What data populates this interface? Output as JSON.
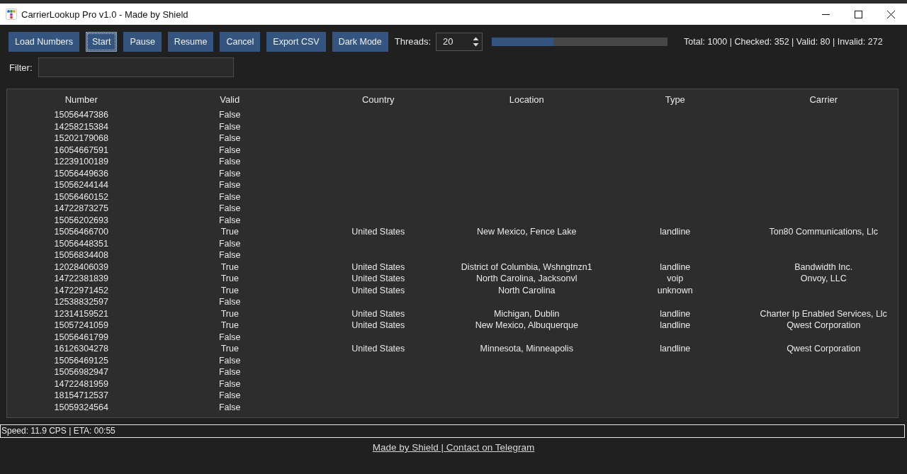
{
  "window": {
    "title": "CarrierLookup Pro v1.0 - Made by Shield"
  },
  "toolbar": {
    "buttons": [
      {
        "label": "Load Numbers",
        "focused": false
      },
      {
        "label": "Start",
        "focused": true
      },
      {
        "label": "Pause",
        "focused": false
      },
      {
        "label": "Resume",
        "focused": false
      },
      {
        "label": "Cancel",
        "focused": false
      },
      {
        "label": "Export CSV",
        "focused": false
      },
      {
        "label": "Dark Mode",
        "focused": false
      }
    ],
    "threads": {
      "label": "Threads:",
      "value": "20"
    },
    "progress": {
      "level": 0.352
    },
    "stats": "Total: 1000 | Checked: 352 | Valid: 80 | Invalid: 272"
  },
  "filter": {
    "label": "Filter:"
  },
  "table": {
    "columns": [
      "Number",
      "Valid",
      "Country",
      "Location",
      "Type",
      "Carrier"
    ],
    "rows": [
      {
        "number": "15056447386",
        "valid": "False"
      },
      {
        "number": "14258215384",
        "valid": "False"
      },
      {
        "number": "15202179068",
        "valid": "False"
      },
      {
        "number": "16054667591",
        "valid": "False"
      },
      {
        "number": "12239100189",
        "valid": "False"
      },
      {
        "number": "15056449636",
        "valid": "False"
      },
      {
        "number": "15056244144",
        "valid": "False"
      },
      {
        "number": "15056460152",
        "valid": "False"
      },
      {
        "number": "14722873275",
        "valid": "False"
      },
      {
        "number": "15056202693",
        "valid": "False"
      },
      {
        "number": "15056466700",
        "valid": "True",
        "country": "United States",
        "location": "New Mexico, Fence Lake",
        "type": "landline",
        "carrier": "Ton80 Communications, Llc"
      },
      {
        "number": "15056448351",
        "valid": "False"
      },
      {
        "number": "15056834408",
        "valid": "False"
      },
      {
        "number": "12028406039",
        "valid": "True",
        "country": "United States",
        "location": "District of Columbia, Wshngtnzn1",
        "type": "landline",
        "carrier": "Bandwidth Inc."
      },
      {
        "number": "14722381839",
        "valid": "True",
        "country": "United States",
        "location": "North Carolina, Jacksonvl",
        "type": "voip",
        "carrier": "Onvoy, LLC"
      },
      {
        "number": "14722971452",
        "valid": "True",
        "country": "United States",
        "location": "North Carolina",
        "type": "unknown"
      },
      {
        "number": "12538832597",
        "valid": "False"
      },
      {
        "number": "12314159521",
        "valid": "True",
        "country": "United States",
        "location": "Michigan, Dublin",
        "type": "landline",
        "carrier": "Charter Ip Enabled Services, Llc"
      },
      {
        "number": "15057241059",
        "valid": "True",
        "country": "United States",
        "location": "New Mexico, Albuquerque",
        "type": "landline",
        "carrier": "Qwest Corporation"
      },
      {
        "number": "15056461799",
        "valid": "False"
      },
      {
        "number": "16126304278",
        "valid": "True",
        "country": "United States",
        "location": "Minnesota, Minneapolis",
        "type": "landline",
        "carrier": "Qwest Corporation"
      },
      {
        "number": "15056469125",
        "valid": "False"
      },
      {
        "number": "15056982947",
        "valid": "False"
      },
      {
        "number": "14722481959",
        "valid": "False"
      },
      {
        "number": "18154712537",
        "valid": "False"
      },
      {
        "number": "15059324564",
        "valid": "False"
      }
    ]
  },
  "status_bar": "Speed: 11.9 CPS | ETA: 00:55",
  "footer_link": "Made by Shield | Contact on Telegram"
}
